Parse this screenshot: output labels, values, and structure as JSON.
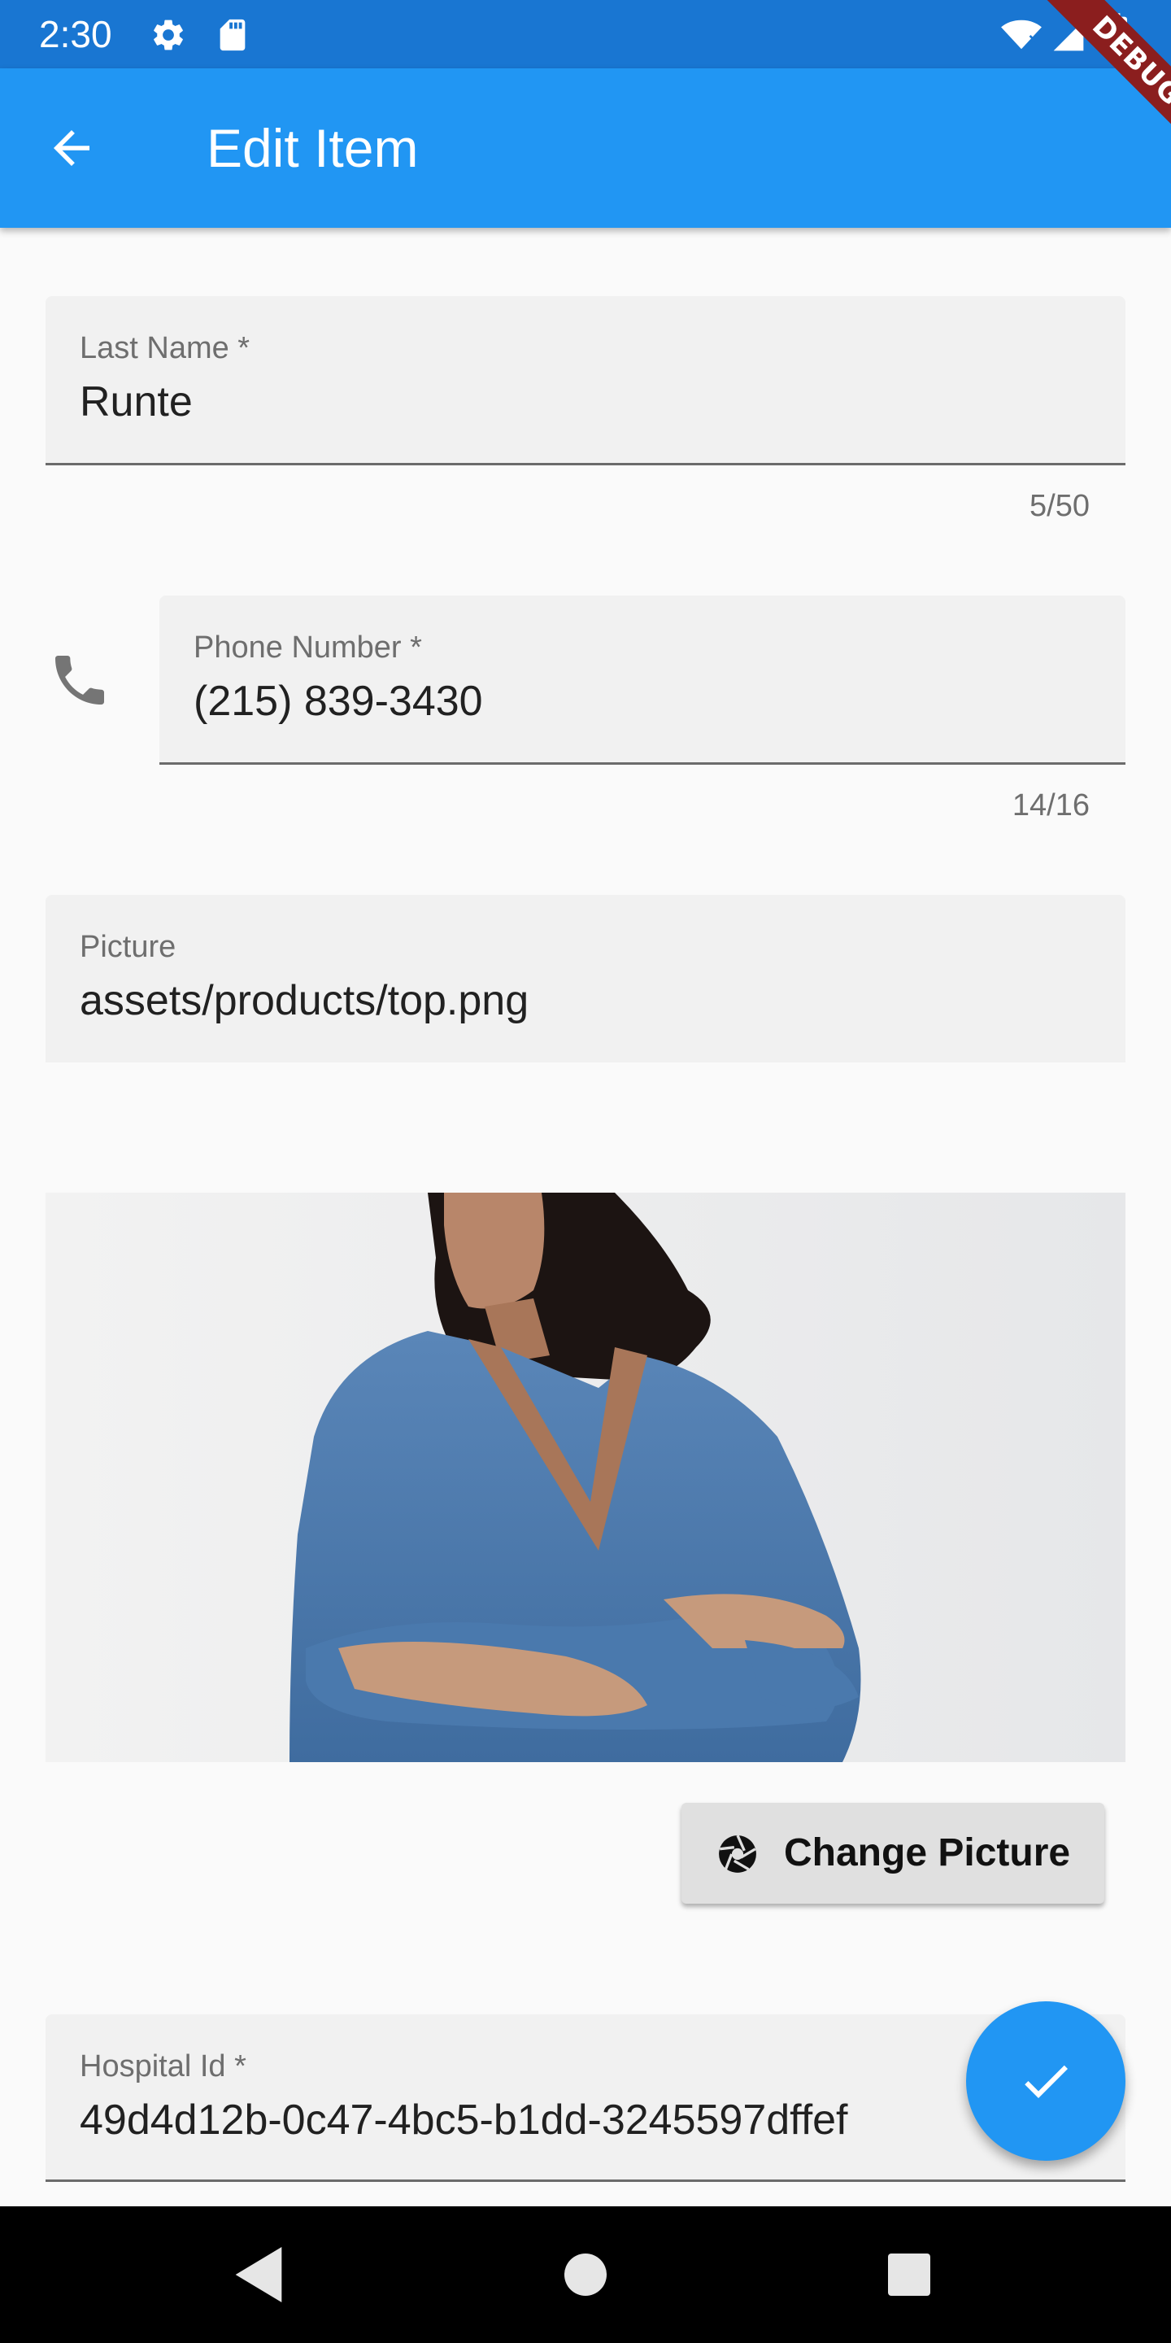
{
  "status_bar": {
    "time": "2:30",
    "debug_label": "DEBUG",
    "icons": [
      "gear-icon",
      "sd-card-icon",
      "wifi-icon",
      "signal-icon",
      "battery-icon"
    ]
  },
  "app_bar": {
    "title": "Edit Item",
    "back_icon": "arrow-back-icon",
    "color": "#2196f3"
  },
  "form": {
    "last_name": {
      "label": "Last Name *",
      "value": "Runte",
      "counter": "5/50"
    },
    "phone": {
      "label": "Phone Number *",
      "value": "(215) 839-3430",
      "counter": "14/16",
      "icon": "phone-icon"
    },
    "picture": {
      "label": "Picture",
      "value": "assets/products/top.png"
    },
    "hospital_id": {
      "label": "Hospital Id *",
      "value": "49d4d12b-0c47-4bc5-b1dd-3245597dffef"
    }
  },
  "change_picture_button": {
    "label": "Change Picture",
    "icon": "camera-shutter-icon"
  },
  "fab": {
    "icon": "check-icon",
    "color": "#2196f3"
  },
  "nav_bar": {
    "icons": [
      "nav-back-icon",
      "nav-home-icon",
      "nav-recents-icon"
    ]
  }
}
